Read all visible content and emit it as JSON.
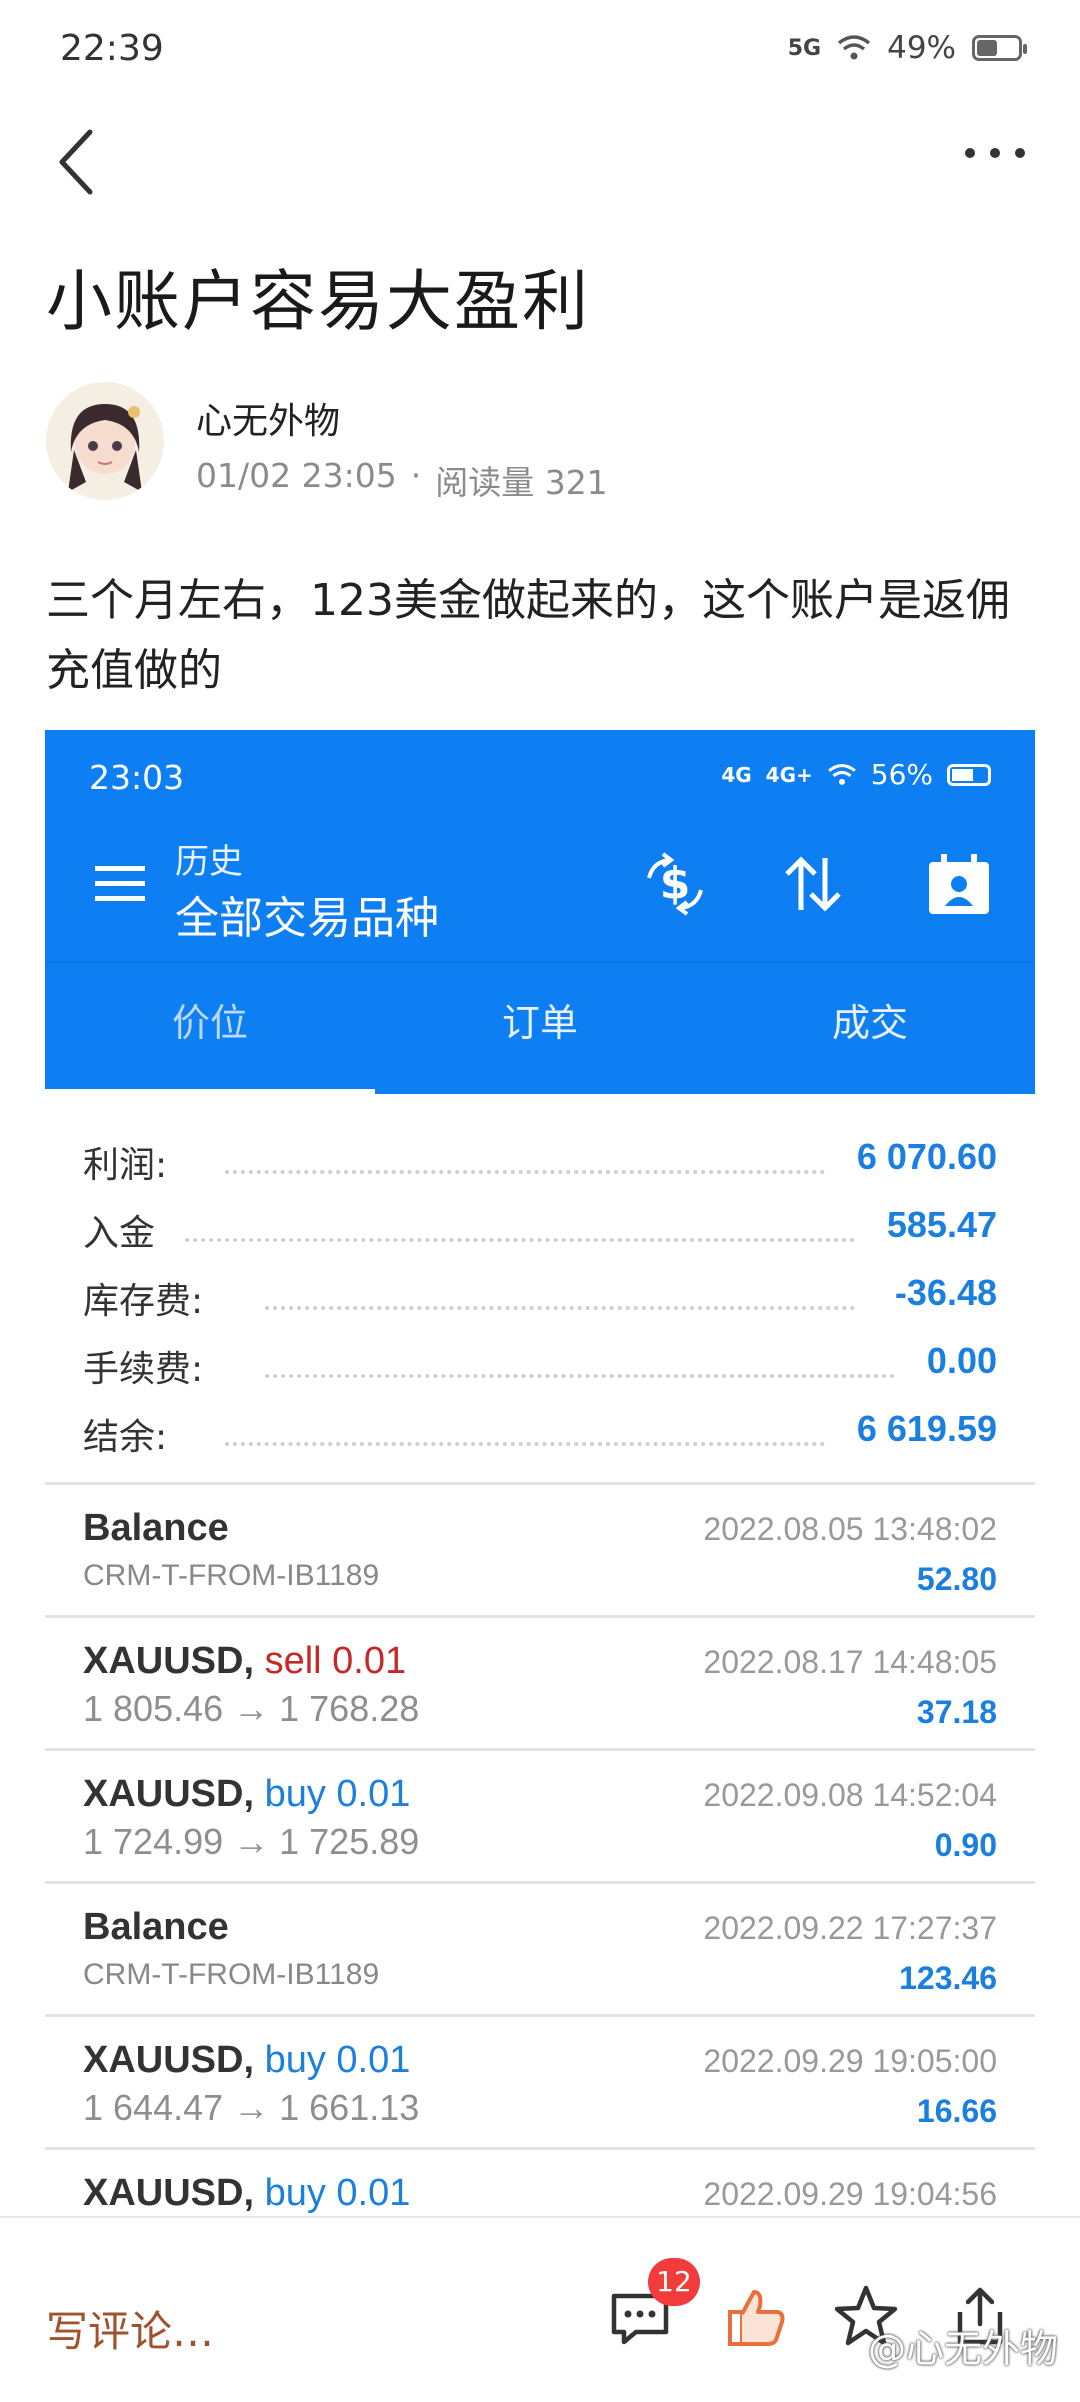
{
  "status_bar": {
    "time": "22:39",
    "network": "5G",
    "battery": "49%"
  },
  "article": {
    "title": "小账户容易大盈利",
    "author": "心无外物",
    "date": "01/02 23:05",
    "separator": "·",
    "reads": "阅读量 321",
    "body": " 三个月左右，123美金做起来的，这个账户是返佣充值做的"
  },
  "embedded": {
    "status": {
      "time": "23:03",
      "net1": "4G",
      "net2": "4G+",
      "battery": "56%"
    },
    "header": {
      "subtitle": "历史",
      "title": "全部交易品种"
    },
    "tabs": [
      "价位",
      "订单",
      "成交"
    ],
    "summary": [
      {
        "label": "利润:",
        "value": "6 070.60"
      },
      {
        "label": "入金",
        "value": "585.47"
      },
      {
        "label": "库存费:",
        "value": "-36.48"
      },
      {
        "label": "手续费:",
        "value": "0.00"
      },
      {
        "label": "结余:",
        "value": "6 619.59"
      }
    ],
    "rows": [
      {
        "symbol": "Balance",
        "side": "",
        "sub": "CRM-T-FROM-IB1189",
        "date": "2022.08.05 13:48:02",
        "amount": "52.80"
      },
      {
        "symbol": "XAUUSD,",
        "side": "sell 0.01",
        "sub": "1 805.46 → 1 768.28",
        "date": "2022.08.17 14:48:05",
        "amount": "37.18"
      },
      {
        "symbol": "XAUUSD,",
        "side": "buy 0.01",
        "sub": "1 724.99 → 1 725.89",
        "date": "2022.09.08 14:52:04",
        "amount": "0.90"
      },
      {
        "symbol": "Balance",
        "side": "",
        "sub": "CRM-T-FROM-IB1189",
        "date": "2022.09.22 17:27:37",
        "amount": "123.46"
      },
      {
        "symbol": "XAUUSD,",
        "side": "buy 0.01",
        "sub": "1 644.47 → 1 661.13",
        "date": "2022.09.29 19:05:00",
        "amount": "16.66"
      },
      {
        "symbol": "XAUUSD,",
        "side": "buy 0.01",
        "sub": "",
        "date": "2022.09.29 19:04:56",
        "amount": ""
      }
    ]
  },
  "bottom_bar": {
    "comment_placeholder": "写评论…",
    "comment_count": "12",
    "watermark": "@心无外物"
  },
  "colors": {
    "accent_blue": "#0d7ff2",
    "value_blue": "#1b7fe0",
    "sell_red": "#c62828",
    "comment_brown": "#a0522d"
  }
}
